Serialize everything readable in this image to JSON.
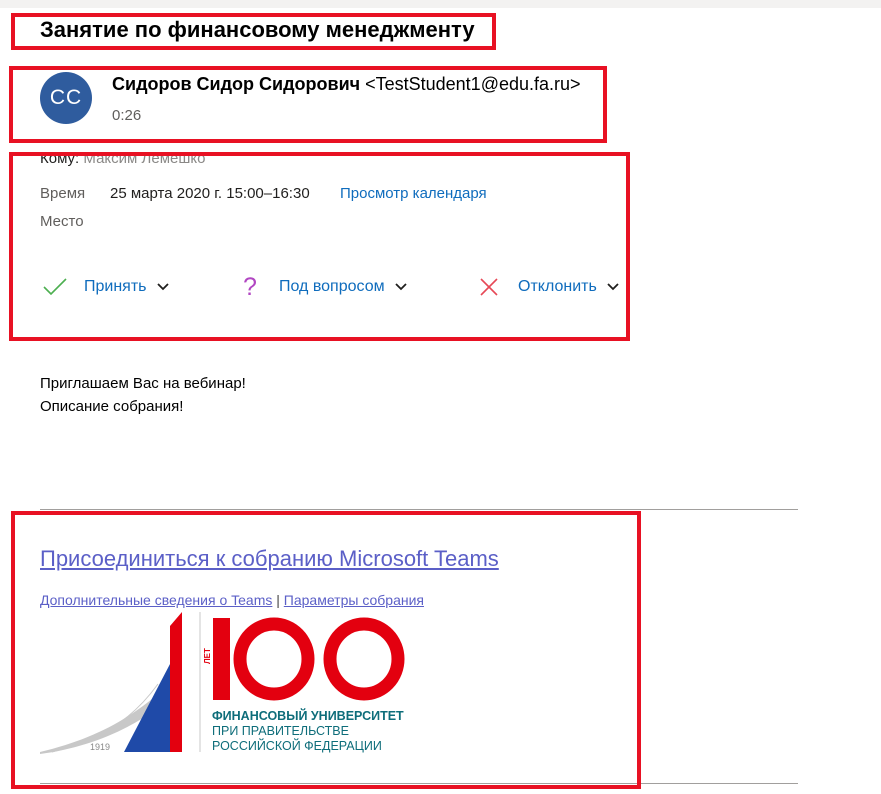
{
  "email": {
    "subject": "Занятие по финансовому менеджменту",
    "sender": {
      "initials": "СС",
      "name": "Сидоров Сидор Сидорович",
      "address": "<TestStudent1@edu.fa.ru>",
      "time": "0:26",
      "avatar_color": "#2f5c9e"
    },
    "to": {
      "label": "Кому:",
      "recipient": "Максим Лемешко"
    },
    "when": {
      "label": "Время",
      "value": "25 марта 2020 г. 15:00–16:30",
      "calendar_link": "Просмотр календаря"
    },
    "where": {
      "label": "Место"
    },
    "responses": {
      "accept": "Принять",
      "tentative": "Под вопросом",
      "decline": "Отклонить"
    },
    "body": {
      "line1": "Приглашаем Вас на вебинар!",
      "line2": "Описание собрания!"
    },
    "teams": {
      "join_link": "Присоединиться к собранию Microsoft Teams",
      "info_link": "Дополнительные сведения о Teams",
      "separator": "|",
      "options_link": "Параметры собрания"
    },
    "logo": {
      "number": "100",
      "years_label": "ЛЕТ",
      "year": "1919",
      "line1": "ФИНАНСОВЫЙ УНИВЕРСИТЕТ",
      "line2": "ПРИ ПРАВИТЕЛЬСТВЕ",
      "line3": "РОССИЙСКОЙ ФЕДЕРАЦИИ"
    }
  },
  "colors": {
    "annotation_red": "#e81123",
    "link_blue": "#0f6cbd",
    "teams_purple": "#5b5fc7",
    "accept_green": "#4caf50",
    "tentative_purple": "#b146c2",
    "decline_red": "#e74856",
    "logo_red": "#e3000f",
    "logo_blue": "#1f4aa8",
    "logo_teal": "#0e6d7a"
  }
}
